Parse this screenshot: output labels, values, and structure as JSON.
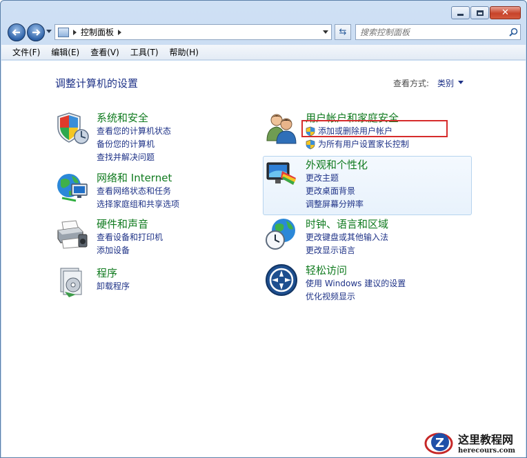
{
  "addressbar": {
    "breadcrumb": "控制面板",
    "search_placeholder": "搜索控制面板"
  },
  "menubar": {
    "items": [
      "文件(F)",
      "编辑(E)",
      "查看(V)",
      "工具(T)",
      "帮助(H)"
    ]
  },
  "page": {
    "title": "调整计算机的设置",
    "view_by_label": "查看方式:",
    "view_by_value": "类别"
  },
  "categories": {
    "system": {
      "title": "系统和安全",
      "links": [
        "查看您的计算机状态",
        "备份您的计算机",
        "查找并解决问题"
      ]
    },
    "network": {
      "title": "网络和 Internet",
      "links": [
        "查看网络状态和任务",
        "选择家庭组和共享选项"
      ]
    },
    "hardware": {
      "title": "硬件和声音",
      "links": [
        "查看设备和打印机",
        "添加设备"
      ]
    },
    "programs": {
      "title": "程序",
      "links": [
        "卸载程序"
      ]
    },
    "users": {
      "title": "用户帐户和家庭安全",
      "links": [
        "添加或删除用户帐户",
        "为所有用户设置家长控制"
      ]
    },
    "appearance": {
      "title": "外观和个性化",
      "links": [
        "更改主题",
        "更改桌面背景",
        "调整屏幕分辨率"
      ]
    },
    "clock": {
      "title": "时钟、语言和区域",
      "links": [
        "更改键盘或其他输入法",
        "更改显示语言"
      ]
    },
    "ease": {
      "title": "轻松访问",
      "links": [
        "使用 Windows 建议的设置",
        "优化视频显示"
      ]
    }
  },
  "watermark": {
    "title": "这里教程网",
    "url": "herecours.com"
  },
  "colors": {
    "category_title": "#0f7a1e",
    "link": "#1e3287",
    "highlight_box": "#d62b2b"
  }
}
